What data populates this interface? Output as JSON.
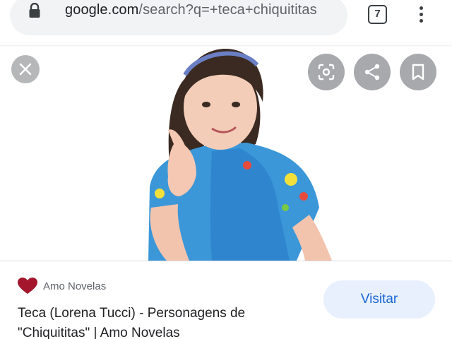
{
  "browser": {
    "url_domain": "google.com",
    "url_path": "/search?q=+teca+chiquititas",
    "tab_count": "7"
  },
  "viewer": {
    "image_subject": "girl-photo",
    "buttons": [
      "close-icon",
      "lens-icon",
      "share-icon",
      "bookmark-icon"
    ]
  },
  "result": {
    "source_name": "Amo Novelas",
    "title_line1": "Teca (Lorena Tucci) - Personagens de",
    "title_line2": "\"Chiquititas\" | Amo Novelas",
    "visit_label": "Visitar"
  },
  "colors": {
    "accent": "#1967d2",
    "visit_bg": "#e8f0fe",
    "heart": "#a3162b"
  }
}
